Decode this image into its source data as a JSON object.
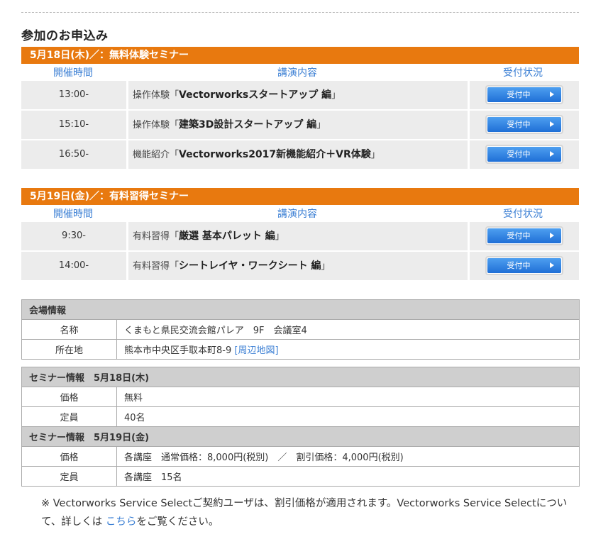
{
  "section_title": "参加のお申込み",
  "columns": {
    "time": "開催時間",
    "content": "講演内容",
    "status": "受付状況"
  },
  "days": [
    {
      "header": "5月18日(木)／：無料体験セミナー",
      "sessions": [
        {
          "time": "13:00-",
          "prefix": "操作体験「",
          "title": "Vectorworksスタートアップ 編",
          "suffix": "」",
          "status": "受付中"
        },
        {
          "time": "15:10-",
          "prefix": "操作体験「",
          "title": "建築3D設計スタートアップ 編",
          "suffix": "」",
          "status": "受付中"
        },
        {
          "time": "16:50-",
          "prefix": "機能紹介「",
          "title": "Vectorworks2017新機能紹介＋VR体験",
          "suffix": "」",
          "status": "受付中"
        }
      ]
    },
    {
      "header": "5月19日(金)／：有料習得セミナー",
      "sessions": [
        {
          "time": "9:30-",
          "prefix": "有料習得「",
          "title": "厳選 基本パレット 編",
          "suffix": "」",
          "status": "受付中"
        },
        {
          "time": "14:00-",
          "prefix": "有料習得「",
          "title": "シートレイヤ・ワークシート 編",
          "suffix": "」",
          "status": "受付中"
        }
      ]
    }
  ],
  "venue": {
    "heading": "会場情報",
    "name_label": "名称",
    "name_value": "くまもと県民交流会館パレア　9F　会議室4",
    "address_label": "所在地",
    "address_value": "熊本市中央区手取本町8-9 ",
    "map_link": "[周辺地図]"
  },
  "seminar_info": [
    {
      "heading": "セミナー情報　5月18日(木)",
      "price_label": "価格",
      "price_value": "無料",
      "capacity_label": "定員",
      "capacity_value": "40名"
    },
    {
      "heading": "セミナー情報　5月19日(金)",
      "price_label": "価格",
      "price_value": "各講座　通常価格：8,000円(税別)　／　割引価格：4,000円(税別)",
      "capacity_label": "定員",
      "capacity_value": "各講座　15名"
    }
  ],
  "note": {
    "text_before": "※ Vectorworks Service Selectご契約ユーザは、割引価格が適用されます。Vectorworks Service Selectについて、詳しくは ",
    "link": "こちら",
    "text_after": "をご覧ください。"
  },
  "colors": {
    "accent": "#e8790f",
    "link": "#3b7fd4",
    "button": "#1f6fd6",
    "row_bg": "#ececec"
  }
}
